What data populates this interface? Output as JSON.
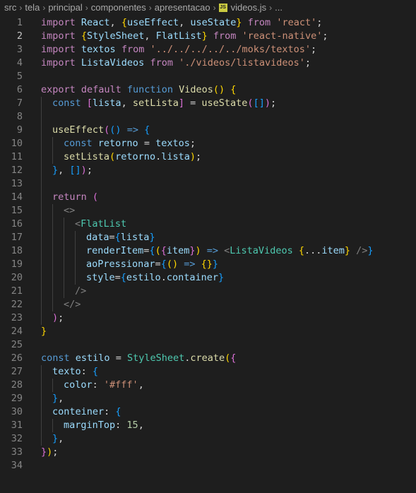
{
  "breadcrumb": {
    "parts": [
      "src",
      "tela",
      "principal",
      "componentes",
      "apresentacao"
    ],
    "file_icon": "JS",
    "file": "videos.js",
    "more": "..."
  },
  "active_line": 2,
  "lines": [
    {
      "n": "1",
      "indent": 0,
      "t": [
        [
          "kw",
          "import "
        ],
        [
          "var",
          "React"
        ],
        [
          "pl",
          ", "
        ],
        [
          "br1",
          "{"
        ],
        [
          "var",
          "useEffect"
        ],
        [
          "pl",
          ", "
        ],
        [
          "var",
          "useState"
        ],
        [
          "br1",
          "}"
        ],
        [
          "kw",
          " from "
        ],
        [
          "str",
          "'react'"
        ],
        [
          "pl",
          ";"
        ]
      ]
    },
    {
      "n": "2",
      "indent": 0,
      "t": [
        [
          "kw",
          "import "
        ],
        [
          "br1",
          "{"
        ],
        [
          "var",
          "StyleSheet"
        ],
        [
          "pl",
          ", "
        ],
        [
          "var",
          "FlatList"
        ],
        [
          "br1",
          "}"
        ],
        [
          "kw",
          " from "
        ],
        [
          "str",
          "'react-native'"
        ],
        [
          "pl",
          ";"
        ]
      ]
    },
    {
      "n": "3",
      "indent": 0,
      "t": [
        [
          "kw",
          "import "
        ],
        [
          "var",
          "textos"
        ],
        [
          "kw",
          " from "
        ],
        [
          "str",
          "'../../../../../moks/textos'"
        ],
        [
          "pl",
          ";"
        ]
      ]
    },
    {
      "n": "4",
      "indent": 0,
      "t": [
        [
          "kw",
          "import "
        ],
        [
          "var",
          "ListaVideos"
        ],
        [
          "kw",
          " from "
        ],
        [
          "str",
          "'./videos/listavideos'"
        ],
        [
          "pl",
          ";"
        ]
      ]
    },
    {
      "n": "5",
      "indent": 0,
      "t": []
    },
    {
      "n": "6",
      "indent": 0,
      "t": [
        [
          "kw",
          "export default "
        ],
        [
          "st",
          "function "
        ],
        [
          "fn",
          "Videos"
        ],
        [
          "br1",
          "()"
        ],
        [
          "pl",
          " "
        ],
        [
          "br1",
          "{"
        ]
      ]
    },
    {
      "n": "7",
      "indent": 1,
      "t": [
        [
          "st",
          "const "
        ],
        [
          "br2",
          "["
        ],
        [
          "var",
          "lista"
        ],
        [
          "pl",
          ", "
        ],
        [
          "fn",
          "setLista"
        ],
        [
          "br2",
          "]"
        ],
        [
          "pl",
          " = "
        ],
        [
          "fn",
          "useState"
        ],
        [
          "br2",
          "("
        ],
        [
          "br3",
          "[]"
        ],
        [
          "br2",
          ")"
        ],
        [
          "pl",
          ";"
        ]
      ]
    },
    {
      "n": "8",
      "indent": 1,
      "t": []
    },
    {
      "n": "9",
      "indent": 1,
      "t": [
        [
          "fn",
          "useEffect"
        ],
        [
          "br2",
          "("
        ],
        [
          "br3",
          "()"
        ],
        [
          "st",
          " => "
        ],
        [
          "br3",
          "{"
        ]
      ]
    },
    {
      "n": "10",
      "indent": 2,
      "t": [
        [
          "st",
          "const "
        ],
        [
          "var",
          "retorno"
        ],
        [
          "pl",
          " = "
        ],
        [
          "var",
          "textos"
        ],
        [
          "pl",
          ";"
        ]
      ]
    },
    {
      "n": "11",
      "indent": 2,
      "t": [
        [
          "fn",
          "setLista"
        ],
        [
          "br1",
          "("
        ],
        [
          "var",
          "retorno"
        ],
        [
          "pl",
          "."
        ],
        [
          "var",
          "lista"
        ],
        [
          "br1",
          ")"
        ],
        [
          "pl",
          ";"
        ]
      ]
    },
    {
      "n": "12",
      "indent": 1,
      "t": [
        [
          "br3",
          "}"
        ],
        [
          "pl",
          ", "
        ],
        [
          "br3",
          "[]"
        ],
        [
          "br2",
          ")"
        ],
        [
          "pl",
          ";"
        ]
      ]
    },
    {
      "n": "13",
      "indent": 1,
      "t": []
    },
    {
      "n": "14",
      "indent": 1,
      "t": [
        [
          "kw",
          "return "
        ],
        [
          "br2",
          "("
        ]
      ]
    },
    {
      "n": "15",
      "indent": 2,
      "t": [
        [
          "grey",
          "<>"
        ]
      ]
    },
    {
      "n": "16",
      "indent": 3,
      "t": [
        [
          "grey",
          "<"
        ],
        [
          "tag",
          "FlatList"
        ]
      ]
    },
    {
      "n": "17",
      "indent": 4,
      "t": [
        [
          "var",
          "data"
        ],
        [
          "pl",
          "="
        ],
        [
          "br3",
          "{"
        ],
        [
          "var",
          "lista"
        ],
        [
          "br3",
          "}"
        ]
      ]
    },
    {
      "n": "18",
      "indent": 4,
      "t": [
        [
          "var",
          "renderItem"
        ],
        [
          "pl",
          "="
        ],
        [
          "br3",
          "{"
        ],
        [
          "br1",
          "("
        ],
        [
          "br2",
          "{"
        ],
        [
          "var",
          "item"
        ],
        [
          "br2",
          "}"
        ],
        [
          "br1",
          ")"
        ],
        [
          "st",
          " => "
        ],
        [
          "grey",
          "<"
        ],
        [
          "tag",
          "ListaVideos "
        ],
        [
          "br1",
          "{"
        ],
        [
          "pl",
          "..."
        ],
        [
          "var",
          "item"
        ],
        [
          "br1",
          "}"
        ],
        [
          "grey",
          " />"
        ],
        [
          "br3",
          "}"
        ]
      ]
    },
    {
      "n": "19",
      "indent": 4,
      "t": [
        [
          "var",
          "aoPressionar"
        ],
        [
          "pl",
          "="
        ],
        [
          "br3",
          "{"
        ],
        [
          "br1",
          "()"
        ],
        [
          "st",
          " => "
        ],
        [
          "br1",
          "{}"
        ],
        [
          "br3",
          "}"
        ]
      ]
    },
    {
      "n": "20",
      "indent": 4,
      "t": [
        [
          "var",
          "style"
        ],
        [
          "pl",
          "="
        ],
        [
          "br3",
          "{"
        ],
        [
          "var",
          "estilo"
        ],
        [
          "pl",
          "."
        ],
        [
          "var",
          "container"
        ],
        [
          "br3",
          "}"
        ]
      ]
    },
    {
      "n": "21",
      "indent": 3,
      "t": [
        [
          "grey",
          "/>"
        ]
      ]
    },
    {
      "n": "22",
      "indent": 2,
      "t": [
        [
          "grey",
          "</>"
        ]
      ]
    },
    {
      "n": "23",
      "indent": 1,
      "t": [
        [
          "br2",
          ")"
        ],
        [
          "pl",
          ";"
        ]
      ]
    },
    {
      "n": "24",
      "indent": 0,
      "t": [
        [
          "br1",
          "}"
        ]
      ]
    },
    {
      "n": "25",
      "indent": 0,
      "t": []
    },
    {
      "n": "26",
      "indent": 0,
      "t": [
        [
          "st",
          "const "
        ],
        [
          "var",
          "estilo"
        ],
        [
          "pl",
          " = "
        ],
        [
          "tag",
          "StyleSheet"
        ],
        [
          "pl",
          "."
        ],
        [
          "fn",
          "create"
        ],
        [
          "br1",
          "("
        ],
        [
          "br2",
          "{"
        ]
      ]
    },
    {
      "n": "27",
      "indent": 1,
      "t": [
        [
          "var",
          "texto"
        ],
        [
          "pl",
          ": "
        ],
        [
          "br3",
          "{"
        ]
      ]
    },
    {
      "n": "28",
      "indent": 2,
      "t": [
        [
          "var",
          "color"
        ],
        [
          "pl",
          ": "
        ],
        [
          "str",
          "'#fff'"
        ],
        [
          "pl",
          ","
        ]
      ]
    },
    {
      "n": "29",
      "indent": 1,
      "t": [
        [
          "br3",
          "}"
        ],
        [
          "pl",
          ","
        ]
      ]
    },
    {
      "n": "30",
      "indent": 1,
      "t": [
        [
          "var",
          "conteiner"
        ],
        [
          "pl",
          ": "
        ],
        [
          "br3",
          "{"
        ]
      ]
    },
    {
      "n": "31",
      "indent": 2,
      "t": [
        [
          "var",
          "marginTop"
        ],
        [
          "pl",
          ": "
        ],
        [
          "num",
          "15"
        ],
        [
          "pl",
          ","
        ]
      ]
    },
    {
      "n": "32",
      "indent": 1,
      "t": [
        [
          "br3",
          "}"
        ],
        [
          "pl",
          ","
        ]
      ]
    },
    {
      "n": "33",
      "indent": 0,
      "t": [
        [
          "br2",
          "}"
        ],
        [
          "br1",
          ")"
        ],
        [
          "pl",
          ";"
        ]
      ]
    },
    {
      "n": "34",
      "indent": 0,
      "t": []
    }
  ]
}
